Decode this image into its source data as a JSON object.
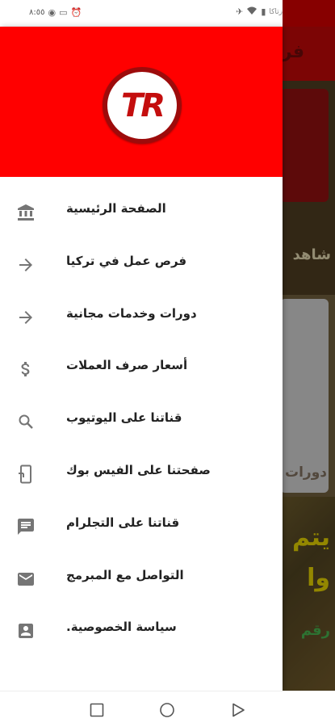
{
  "status_bar": {
    "time": "٨:٥٥",
    "right_text": "زتاکا"
  },
  "background_app": {
    "header_title": "فر",
    "card1_text": "شاهد",
    "card2_text": "دورات",
    "lower_line1": "يتم",
    "lower_line2": "وا",
    "lower_line3": "رقم"
  },
  "drawer": {
    "logo_text": {
      "t": "T",
      "r": "R"
    },
    "items": [
      {
        "label": "الصفحة الرئيسية",
        "icon": "bank-icon"
      },
      {
        "label": "فرص عمل في تركيا",
        "icon": "arrow-right-icon"
      },
      {
        "label": "دورات وخدمات مجانية",
        "icon": "arrow-right-icon"
      },
      {
        "label": "أسعار صرف العملات",
        "icon": "dollar-icon"
      },
      {
        "label": "قناتنا على اليوتيوب",
        "icon": "search-icon"
      },
      {
        "label": "صفحتنا على الفيس بوك",
        "icon": "phone-link-icon"
      },
      {
        "label": "قناتنا على التجلرام",
        "icon": "chat-icon"
      },
      {
        "label": "التواصل مع المبرمج",
        "icon": "mail-icon"
      },
      {
        "label": "سياسة الخصوصية.",
        "icon": "contact-card-icon"
      }
    ]
  },
  "navigation_bar": {
    "buttons": [
      "recent-apps-button",
      "home-button",
      "back-button"
    ]
  },
  "colors": {
    "drawer_header": "#ff0000",
    "app_header": "#b70808",
    "menu_text": "#222222",
    "icon": "#757575"
  }
}
